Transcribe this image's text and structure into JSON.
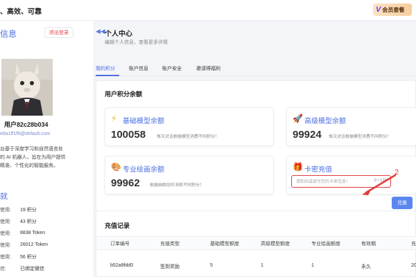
{
  "topbar": {
    "tagline": "、高效、可靠",
    "vip_letter": "V",
    "vip_label": "会员套餐"
  },
  "sidebar": {
    "title": "信息",
    "logout_label": "退出登录",
    "username": "用户82c28b034",
    "email": "e8a1ff1f9@default.com",
    "bio": [
      "台基于深度学习和自然语言处",
      "的 AI 机器人，旨在为用户提供",
      "精准、个性化的智能服务。"
    ],
    "achievements_title": "就",
    "achievements": [
      {
        "key": "使用:",
        "value": "19 积分"
      },
      {
        "key": "使用:",
        "value": "43 积分"
      },
      {
        "key": "使用:",
        "value": "8838 Token"
      },
      {
        "key": "使用:",
        "value": "26012 Token"
      },
      {
        "key": "使用:",
        "value": "56 积分"
      },
      {
        "key": "信:",
        "value": "已绑定微信"
      }
    ]
  },
  "main": {
    "icon": "arrow-left-icon",
    "title": "个人中心",
    "subtitle": "编辑个人信息、查看更多详情",
    "tabs": [
      "我的积分",
      "账户信息",
      "账户安全",
      "邀请得福利"
    ],
    "points": {
      "title": "用户积分余额",
      "basic": {
        "label": "基础模型余额",
        "value": "100058",
        "note": "每次对话根据模型消费不同积分！"
      },
      "advanced": {
        "label": "高级模型余额",
        "value": "99924",
        "note": "每次对话根据模型消费不同积分！"
      },
      "drawing": {
        "label": "专业绘画余额",
        "value": "99962",
        "note": "根据画图动作消耗不同积分！"
      },
      "card": {
        "label": "卡密充值",
        "placeholder": "请粘贴或填写您的卡密信息！",
        "count": "0 / 128",
        "redeem_label": "兑换"
      }
    },
    "annotation_number": "2",
    "recharge": {
      "title": "充值记录",
      "columns": [
        "订单编号",
        "充值类型",
        "基础模型额度",
        "高级模型额度",
        "专业绘画额度",
        "有效期",
        "充"
      ],
      "rows": [
        [
          "b52a8fdd0",
          "签到奖励",
          "5",
          "1",
          "1",
          "永久",
          "20"
        ]
      ]
    }
  },
  "colors": {
    "accent": "#4a6ee0",
    "annotation": "#e33b3b",
    "button": "#5b86f0"
  }
}
